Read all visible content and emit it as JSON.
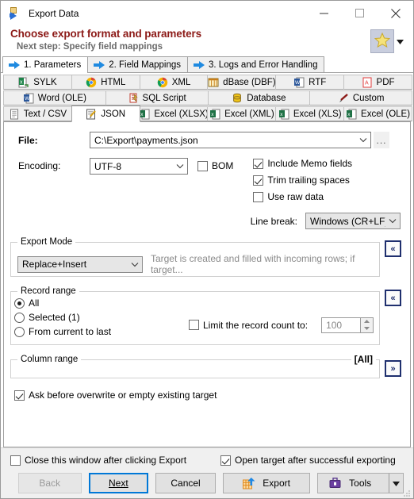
{
  "window": {
    "title": "Export Data",
    "icon": "export-data-icon",
    "minimize": "minimize-icon",
    "maximize": "maximize-icon",
    "close": "close-icon"
  },
  "header": {
    "heading": "Choose export format and parameters",
    "subheading": "Next step: Specify field mappings",
    "favorites_icon": "star-icon",
    "favorites_dropdown": "chevron-down-icon",
    "heading_color": "#8c1a17",
    "subheading_color": "#6b6b6b"
  },
  "step_tabs": [
    {
      "label": "1. Parameters",
      "active": true
    },
    {
      "label": "2. Field Mappings",
      "active": false
    },
    {
      "label": "3. Logs and Error Handling",
      "active": false
    }
  ],
  "format_tabs": {
    "row1": [
      {
        "label": "SYLK",
        "icon": "sylk-icon",
        "active": false
      },
      {
        "label": "HTML",
        "icon": "chrome-icon",
        "active": false
      },
      {
        "label": "XML",
        "icon": "chrome-icon",
        "active": false
      },
      {
        "label": "dBase (DBF)",
        "icon": "dbase-icon",
        "active": false
      },
      {
        "label": "RTF",
        "icon": "word-icon",
        "active": false
      },
      {
        "label": "PDF",
        "icon": "pdf-icon",
        "active": false
      }
    ],
    "row2": [
      {
        "label": "Word (OLE)",
        "icon": "word-icon",
        "active": false
      },
      {
        "label": "SQL Script",
        "icon": "sql-script-icon",
        "active": false
      },
      {
        "label": "Database",
        "icon": "database-icon",
        "active": false
      },
      {
        "label": "Custom",
        "icon": "pencil-icon",
        "active": false
      }
    ],
    "row3": [
      {
        "label": "Text / CSV",
        "icon": "text-file-icon",
        "active": false
      },
      {
        "label": "JSON",
        "icon": "json-icon",
        "active": true
      },
      {
        "label": "Excel (XLSX)",
        "icon": "excel-icon",
        "active": false
      },
      {
        "label": "Excel (XML)",
        "icon": "excel-icon",
        "active": false
      },
      {
        "label": "Excel (XLS)",
        "icon": "excel-icon",
        "active": false
      },
      {
        "label": "Excel (OLE)",
        "icon": "excel-icon",
        "active": false
      }
    ]
  },
  "main": {
    "file_label": "File:",
    "file_value": "C:\\Export\\payments.json",
    "browse_label": "...",
    "encoding_label": "Encoding:",
    "encoding_value": "UTF-8",
    "bom_label": "BOM",
    "bom_checked": false,
    "include_memo_label": "Include Memo fields",
    "include_memo_checked": true,
    "trim_trailing_label": "Trim trailing spaces",
    "trim_trailing_checked": true,
    "use_raw_label": "Use raw data",
    "use_raw_checked": false,
    "line_break_label": "Line break:",
    "line_break_value": "Windows (CR+LF)",
    "export_mode": {
      "legend": "Export Mode",
      "value": "Replace+Insert",
      "hint": "Target is created and filled with incoming rows; if target...",
      "collapse_icon": "«"
    },
    "record_range": {
      "legend": "Record range",
      "options": [
        {
          "label": "All",
          "selected": true
        },
        {
          "label": "Selected (1)",
          "selected": false
        },
        {
          "label": "From current to last",
          "selected": false
        }
      ],
      "limit_label": "Limit the record count to:",
      "limit_checked": false,
      "limit_value": "100",
      "collapse_icon": "«"
    },
    "column_range": {
      "legend": "Column range",
      "value": "[All]",
      "expand_icon": "»"
    },
    "ask_before_overwrite_label": "Ask before overwrite or empty existing target",
    "ask_before_overwrite_checked": true
  },
  "footer": {
    "close_window_label": "Close this window after clicking Export",
    "close_window_checked": false,
    "open_target_label": "Open target after successful exporting",
    "open_target_checked": true,
    "buttons": {
      "back": "Back",
      "next": "Next",
      "cancel": "Cancel",
      "export": "Export",
      "tools": "Tools",
      "tools_dropdown": "chevron-down-icon",
      "export_icon": "export-table-icon",
      "tools_icon": "toolbox-icon"
    }
  }
}
